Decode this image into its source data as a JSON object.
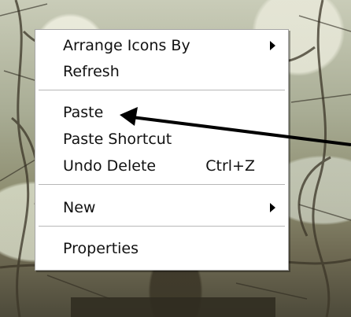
{
  "context_menu": {
    "items": [
      {
        "label": "Arrange Icons By",
        "shortcut": "",
        "has_submenu": true
      },
      {
        "label": "Refresh",
        "shortcut": "",
        "has_submenu": false
      },
      {
        "label": "Paste",
        "shortcut": "",
        "has_submenu": false
      },
      {
        "label": "Paste Shortcut",
        "shortcut": "",
        "has_submenu": false
      },
      {
        "label": "Undo Delete",
        "shortcut": "Ctrl+Z",
        "has_submenu": false
      },
      {
        "label": "New",
        "shortcut": "",
        "has_submenu": true
      },
      {
        "label": "Properties",
        "shortcut": "",
        "has_submenu": false
      }
    ]
  },
  "annotation": {
    "arrow_color": "#000000",
    "target_item": "Paste"
  },
  "icons": {
    "submenu": "chevron-right-icon",
    "annotation": "pointer-arrow-icon"
  }
}
